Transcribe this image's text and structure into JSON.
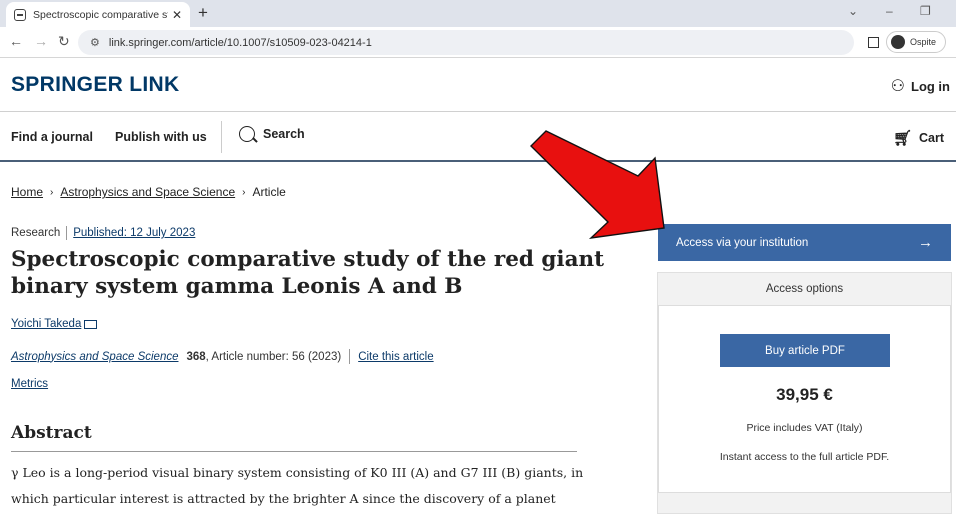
{
  "browser": {
    "tab_title": "Spectroscopic comparative study",
    "url": "link.springer.com/article/10.1007/s10509-023-04214-1",
    "profile_label": "Ospite"
  },
  "site": {
    "logo": "SPRINGER LINK",
    "login": "Log in",
    "nav": {
      "find_journal": "Find a journal",
      "publish": "Publish with us",
      "search": "Search",
      "cart": "Cart"
    }
  },
  "breadcrumb": {
    "home": "Home",
    "category": "Astrophysics and Space Science",
    "current": "Article"
  },
  "article": {
    "type": "Research",
    "published": "Published: 12 July 2023",
    "title": "Spectroscopic comparative study of the red giant binary system gamma Leonis A and B",
    "author": "Yoichi Takeda",
    "journal": "Astrophysics and Space Science",
    "volume": "368",
    "article_number": ", Article number: 56 (2023)",
    "cite": "Cite this article",
    "metrics": "Metrics",
    "abstract_heading": "Abstract",
    "abstract_text": "γ Leo is a long-period visual binary system consisting of K0 III (A) and G7 III (B) giants, in which particular interest is attracted by the brighter A since the discovery of a planet around"
  },
  "access": {
    "institution_button": "Access via your institution",
    "options_title": "Access options",
    "buy_button": "Buy article PDF",
    "price": "39,95 €",
    "vat_note": "Price includes VAT (Italy)",
    "instant_note": "Instant access to the full article PDF."
  },
  "colors": {
    "brand": "#013866",
    "button": "#3a67a4",
    "annotation_arrow": "#e8100f"
  }
}
